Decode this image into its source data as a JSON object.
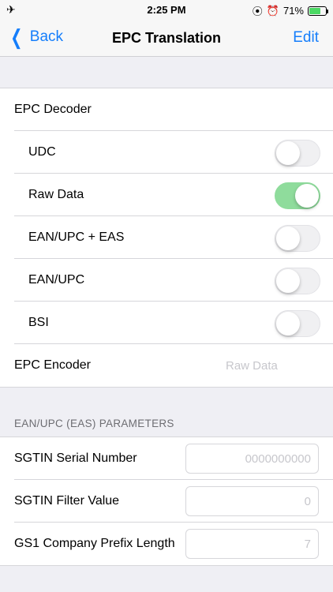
{
  "status": {
    "time": "2:25 PM",
    "battery": "71%"
  },
  "nav": {
    "back_label": "Back",
    "title": "EPC Translation",
    "edit_label": "Edit",
    "accent": "#157efb"
  },
  "decoder": {
    "title": "EPC Decoder",
    "options": [
      {
        "label": "UDC",
        "on": false
      },
      {
        "label": "Raw Data",
        "on": true
      },
      {
        "label": "EAN/UPC + EAS",
        "on": false
      },
      {
        "label": "EAN/UPC",
        "on": false
      },
      {
        "label": "BSI",
        "on": false
      }
    ]
  },
  "encoder": {
    "label": "EPC Encoder",
    "value": "Raw Data"
  },
  "params": {
    "header": "EAN/UPC (EAS) PARAMETERS",
    "fields": [
      {
        "label": "SGTIN Serial Number",
        "placeholder": "0000000000"
      },
      {
        "label": "SGTIN Filter Value",
        "placeholder": "0"
      },
      {
        "label": "GS1 Company Prefix Length",
        "placeholder": "7"
      }
    ]
  },
  "icons": {
    "airplane": "airplane-icon",
    "orientation_lock": "orientation-lock-icon",
    "alarm": "alarm-icon",
    "battery": "battery-icon",
    "back": "chevron-left-icon"
  },
  "colors": {
    "toggle_on": "#8fdc9c",
    "background": "#efeff4"
  }
}
